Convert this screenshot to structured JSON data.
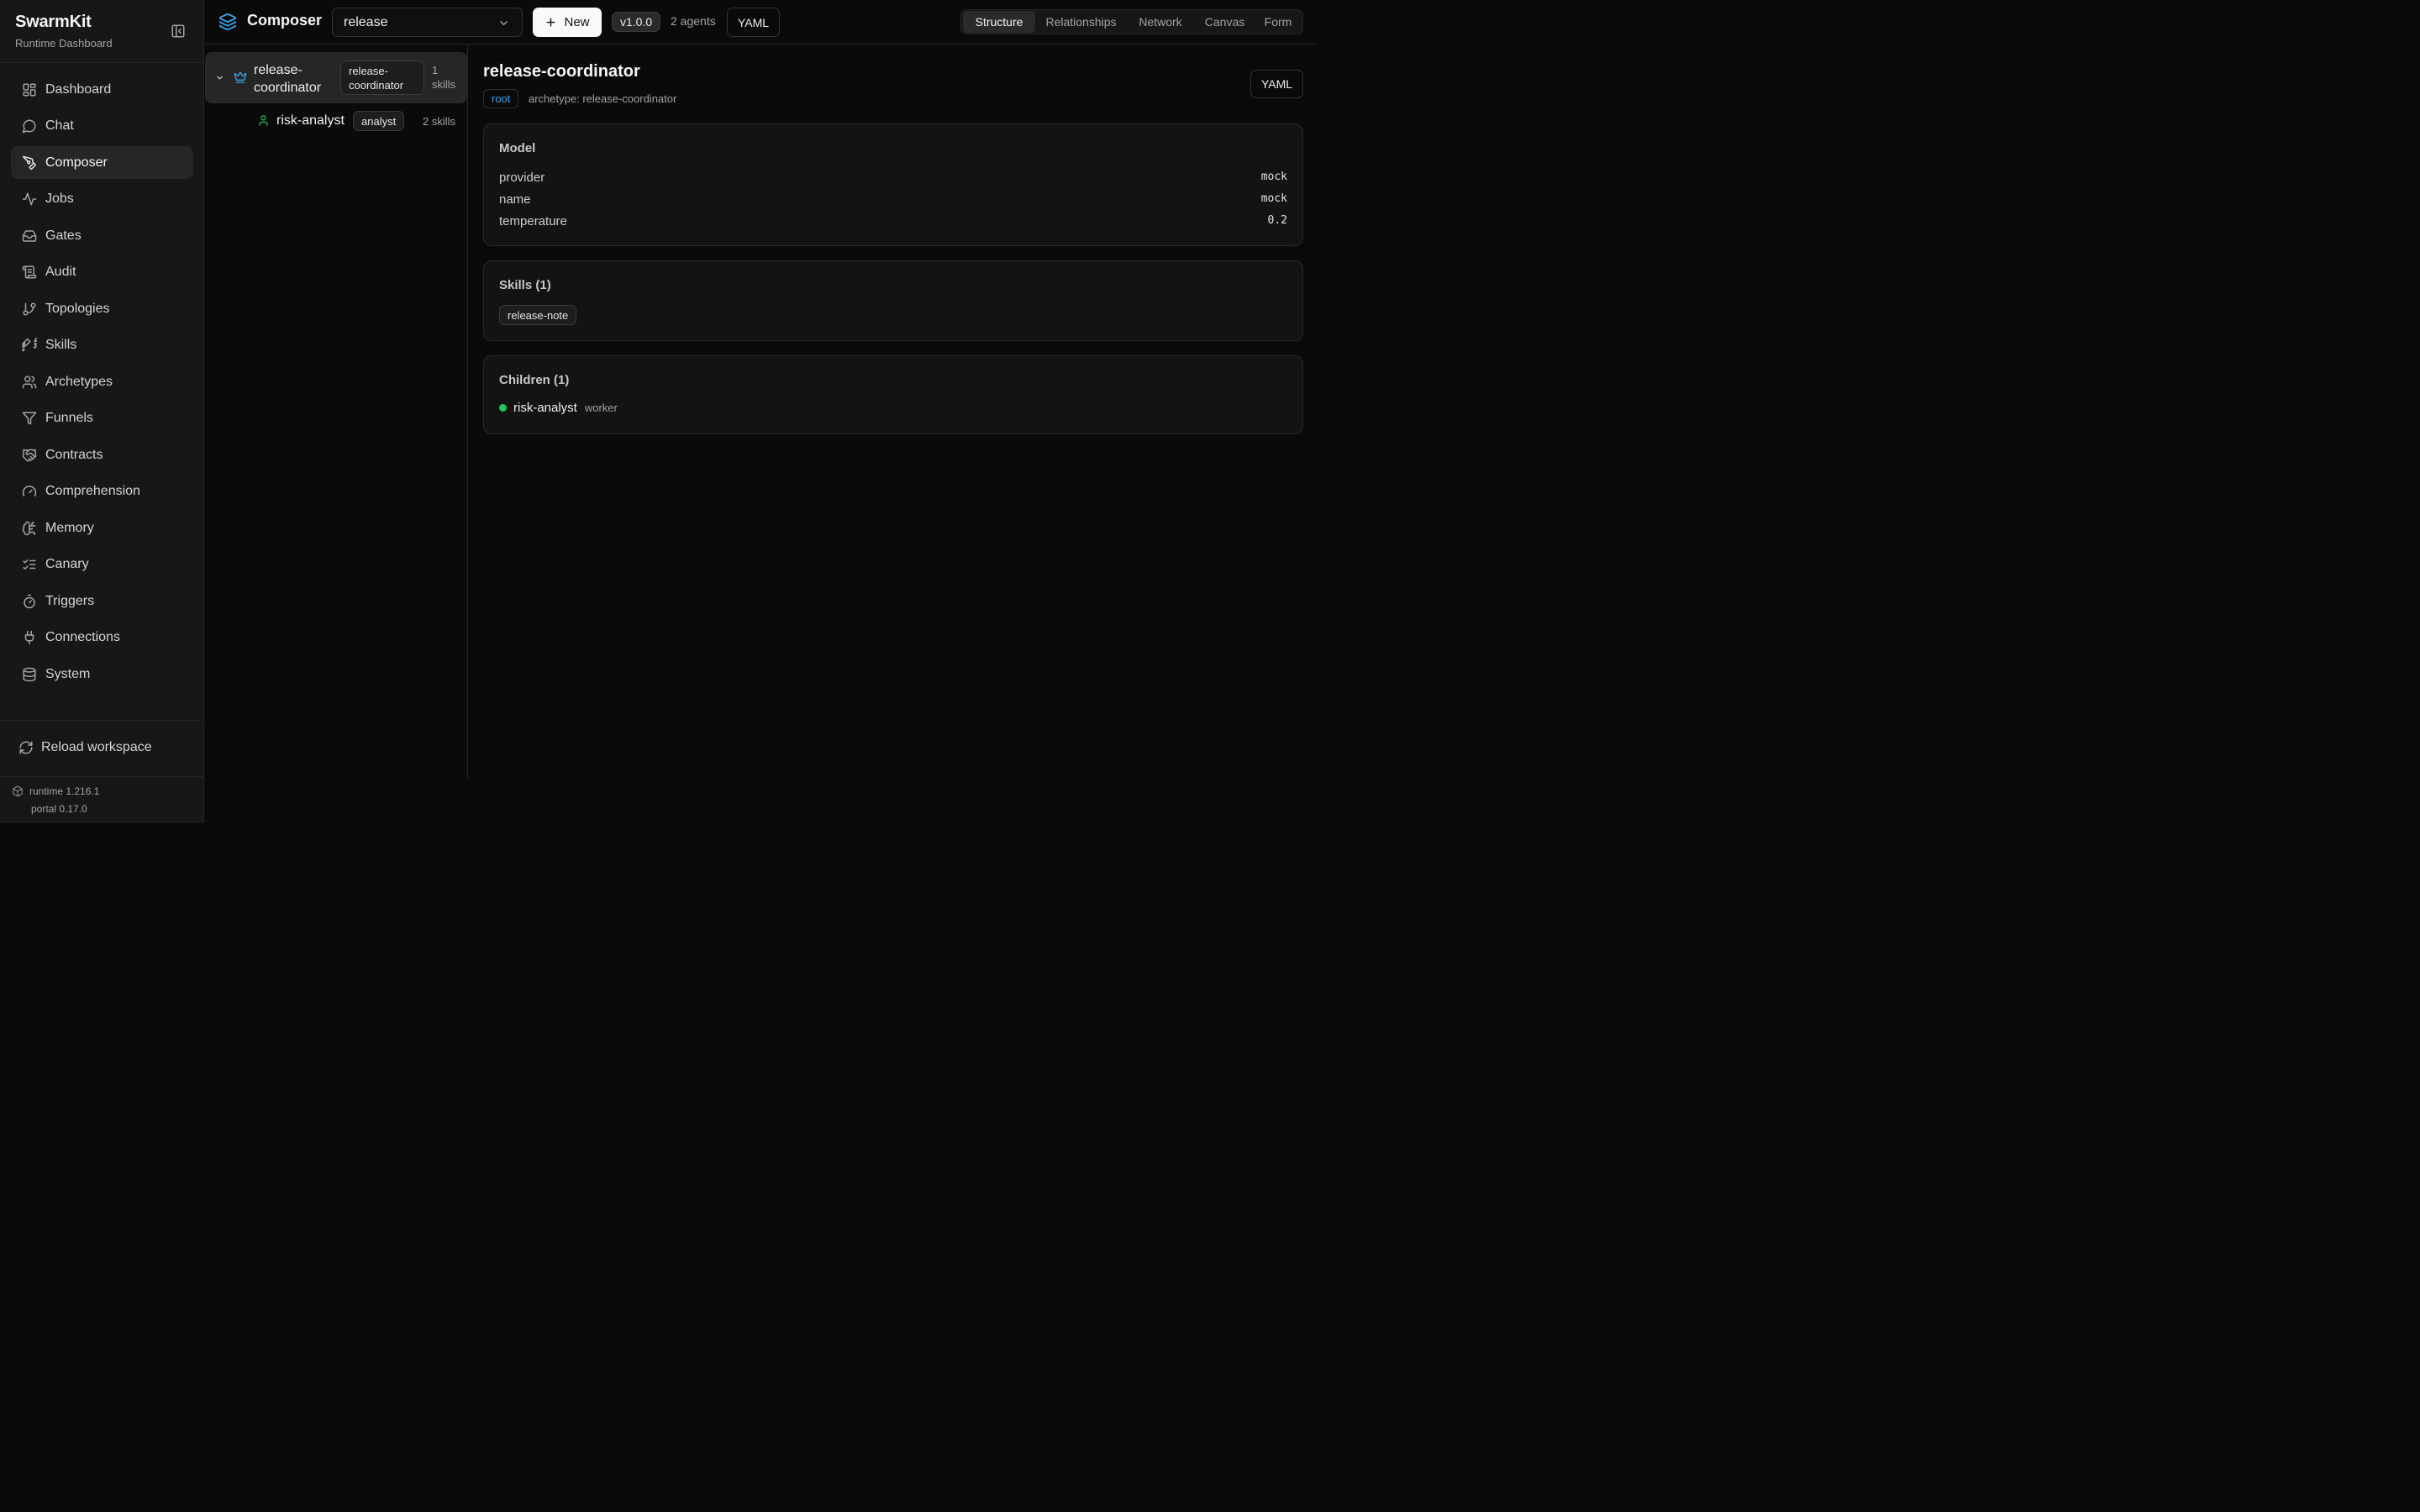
{
  "sidebar": {
    "brand_title": "SwarmKit",
    "brand_subtitle": "Runtime Dashboard",
    "items": [
      {
        "label": "Dashboard",
        "icon": "layout-grid-icon"
      },
      {
        "label": "Chat",
        "icon": "message-circle-icon"
      },
      {
        "label": "Composer",
        "icon": "pen-tool-icon",
        "active": true
      },
      {
        "label": "Jobs",
        "icon": "activity-icon"
      },
      {
        "label": "Gates",
        "icon": "inbox-icon"
      },
      {
        "label": "Audit",
        "icon": "scroll-icon"
      },
      {
        "label": "Topologies",
        "icon": "git-branch-icon"
      },
      {
        "label": "Skills",
        "icon": "puzzle-icon"
      },
      {
        "label": "Archetypes",
        "icon": "users-icon"
      },
      {
        "label": "Funnels",
        "icon": "funnel-icon"
      },
      {
        "label": "Contracts",
        "icon": "handshake-icon"
      },
      {
        "label": "Comprehension",
        "icon": "gauge-icon"
      },
      {
        "label": "Memory",
        "icon": "brain-icon"
      },
      {
        "label": "Canary",
        "icon": "list-checks-icon"
      },
      {
        "label": "Triggers",
        "icon": "timer-icon"
      },
      {
        "label": "Connections",
        "icon": "plug-icon"
      },
      {
        "label": "System",
        "icon": "database-icon"
      }
    ],
    "reload_label": "Reload workspace",
    "runtime_version": "runtime 1.216.1",
    "portal_version": "portal 0.17.0"
  },
  "topbar": {
    "title": "Composer",
    "selected_topology": "release",
    "new_label": "New",
    "version": "v1.0.0",
    "agents_count": "2 agents",
    "yaml_label": "YAML",
    "tabs": [
      {
        "label": "Structure",
        "active": true
      },
      {
        "label": "Relationships"
      },
      {
        "label": "Network"
      },
      {
        "label": "Canvas"
      },
      {
        "label": "Form"
      }
    ]
  },
  "tree": {
    "root": {
      "name_line1": "release-",
      "name_line2": "coordinator",
      "archetype_line1": "release-",
      "archetype_line2": "coordinator",
      "skills_line1": "1",
      "skills_line2": "skills"
    },
    "child": {
      "name": "risk-analyst",
      "archetype": "analyst",
      "skills": "2 skills"
    }
  },
  "detail": {
    "title": "release-coordinator",
    "root_badge": "root",
    "archetype_line": "archetype: release-coordinator",
    "yaml_label": "YAML",
    "model": {
      "title": "Model",
      "fields": [
        {
          "key": "provider",
          "value": "mock"
        },
        {
          "key": "name",
          "value": "mock"
        },
        {
          "key": "temperature",
          "value": "0.2"
        }
      ]
    },
    "skills": {
      "title": "Skills (1)",
      "items": [
        "release-note"
      ]
    },
    "children": {
      "title": "Children (1)",
      "items": [
        {
          "name": "risk-analyst",
          "role": "worker",
          "status_color": "#22c55e"
        }
      ]
    }
  },
  "colors": {
    "accent": "#3ba3e6",
    "success": "#22c55e",
    "background": "#0a0a0a",
    "sidebar": "#171717"
  }
}
